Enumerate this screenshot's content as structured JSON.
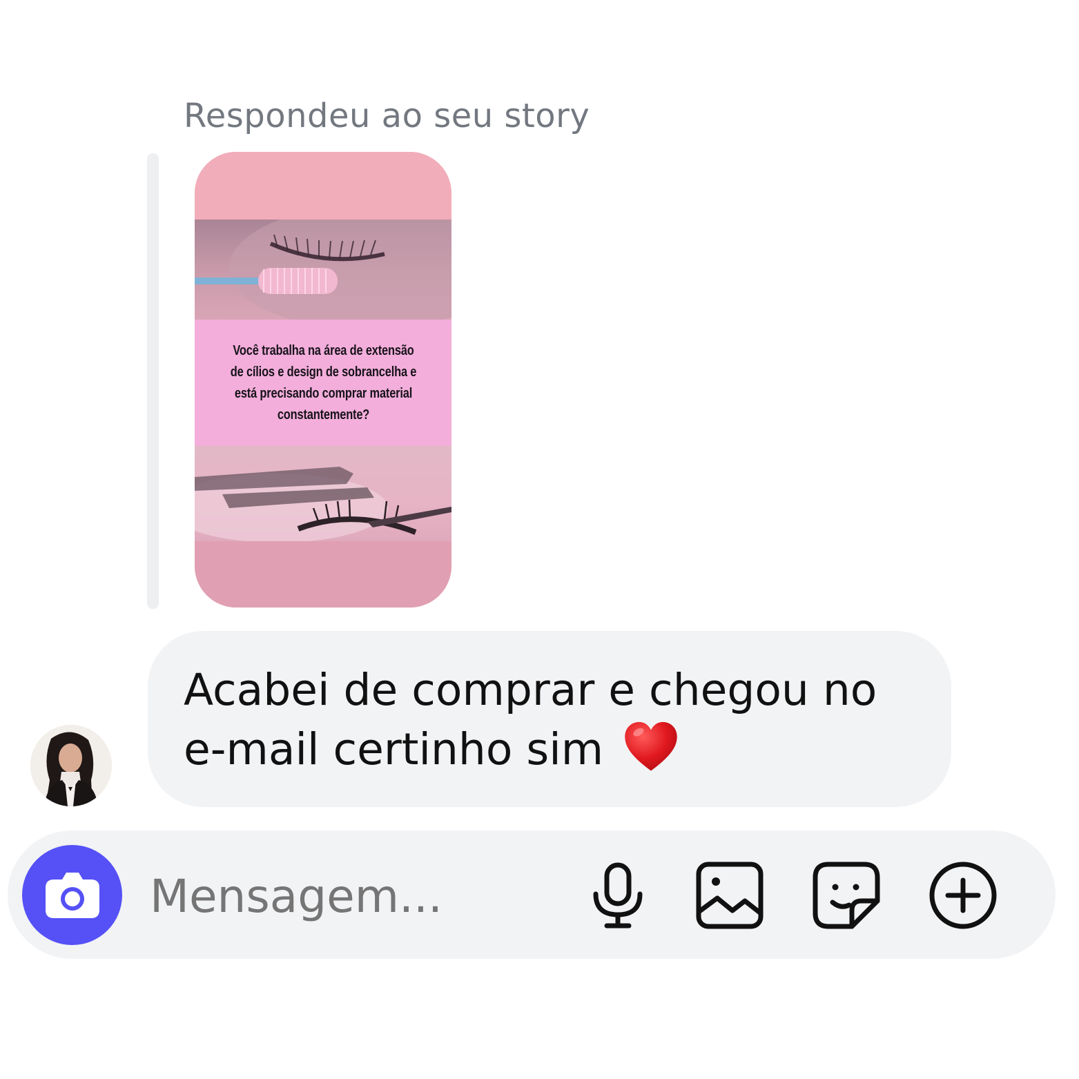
{
  "reply_context": {
    "label": "Respondeu ao seu story"
  },
  "story": {
    "caption": "Você trabalha na área de extensão de cílios e design de sobrancelha e está precisando comprar material constantemente?"
  },
  "message": {
    "text": "Acabei de comprar e chegou no e-mail certinho sim",
    "emoji": "red-heart"
  },
  "composer": {
    "placeholder": "Mensagem...",
    "icons": [
      "camera-icon",
      "microphone-icon",
      "gallery-icon",
      "sticker-icon",
      "add-circle-icon"
    ]
  },
  "colors": {
    "accent": "#5551f6",
    "bubble_bg": "#f2f3f5",
    "secondary_text": "#737880"
  }
}
